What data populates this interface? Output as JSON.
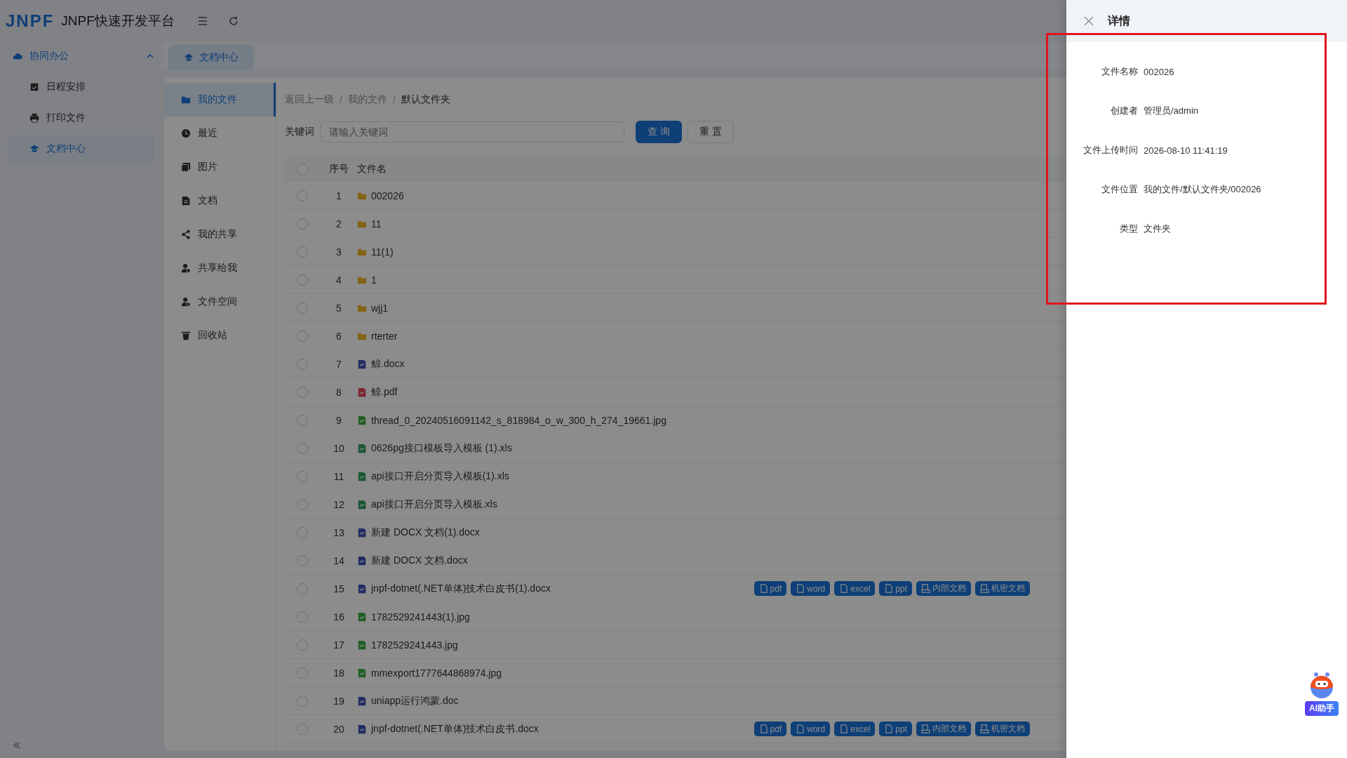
{
  "app": {
    "logo": "JNPF",
    "title": "JNPF快速开发平台"
  },
  "sidebar": {
    "group": {
      "label": "协同办公",
      "expanded": true,
      "items": [
        {
          "label": "日程安排",
          "selected": false
        },
        {
          "label": "打印文件",
          "selected": false
        },
        {
          "label": "文档中心",
          "selected": true
        }
      ]
    }
  },
  "tabs": [
    {
      "label": "文档中心",
      "selected": true
    }
  ],
  "nav": [
    {
      "label": "我的文件",
      "selected": true
    },
    {
      "label": "最近",
      "selected": false
    },
    {
      "label": "图片",
      "selected": false
    },
    {
      "label": "文档",
      "selected": false
    },
    {
      "label": "我的共享",
      "selected": false
    },
    {
      "label": "共享给我",
      "selected": false
    },
    {
      "label": "文件空间",
      "selected": false
    },
    {
      "label": "回收站",
      "selected": false
    }
  ],
  "breadcrumb": [
    {
      "label": "返回上一级"
    },
    {
      "separator": "/",
      "label": "我的文件"
    },
    {
      "separator": "/",
      "label": "默认文件夹"
    }
  ],
  "search": {
    "label": "关键词",
    "placeholder": "请输入关键词",
    "buttons": [
      {
        "label": "查 询",
        "kind": "primary"
      },
      {
        "label": "重 置",
        "kind": "default"
      }
    ]
  },
  "table": {
    "columns": [
      "序号",
      "文件名"
    ],
    "all_checked": false,
    "rows": [
      {
        "index": "1",
        "name": "002026",
        "kind": "folder",
        "checked": false
      },
      {
        "index": "2",
        "name": "11",
        "kind": "folder",
        "checked": false
      },
      {
        "index": "3",
        "name": "11(1)",
        "kind": "folder",
        "checked": false
      },
      {
        "index": "4",
        "name": "1",
        "kind": "folder",
        "checked": false
      },
      {
        "index": "5",
        "name": "wjj1",
        "kind": "folder",
        "checked": false
      },
      {
        "index": "6",
        "name": "rterter",
        "kind": "folder",
        "checked": false
      },
      {
        "index": "7",
        "name": "鲸.docx",
        "kind": "word",
        "checked": false
      },
      {
        "index": "8",
        "name": "鲸.pdf",
        "kind": "pdf",
        "checked": false
      },
      {
        "index": "9",
        "name": "thread_0_20240516091142_s_818984_o_w_300_h_274_19661.jpg",
        "kind": "image",
        "checked": false
      },
      {
        "index": "10",
        "name": "0626pg接口模板导入模板 (1).xls",
        "kind": "excel",
        "checked": false
      },
      {
        "index": "11",
        "name": "api接口开启分页导入模板(1).xls",
        "kind": "excel",
        "checked": false
      },
      {
        "index": "12",
        "name": "api接口开启分页导入模板.xls",
        "kind": "excel",
        "checked": false
      },
      {
        "index": "13",
        "name": "新建 DOCX 文档(1).docx",
        "kind": "word",
        "checked": false
      },
      {
        "index": "14",
        "name": "新建 DOCX 文档.docx",
        "kind": "word",
        "checked": false
      },
      {
        "index": "15",
        "name": "jnpf-dotnet(.NET单体)技术白皮书(1).docx",
        "kind": "word",
        "checked": false,
        "tags": [
          {
            "label": "pdf",
            "kind": "pdf"
          },
          {
            "label": "word",
            "kind": "word"
          },
          {
            "label": "excel",
            "kind": "excel"
          },
          {
            "label": "ppt",
            "kind": "ppt"
          },
          {
            "label": "内部文档",
            "kind": "internal"
          },
          {
            "label": "机密文档",
            "kind": "secret"
          }
        ]
      },
      {
        "index": "16",
        "name": "1782529241443(1).jpg",
        "kind": "image",
        "checked": false
      },
      {
        "index": "17",
        "name": "1782529241443.jpg",
        "kind": "image",
        "checked": false
      },
      {
        "index": "18",
        "name": "mmexport1777644868974.jpg",
        "kind": "image",
        "checked": false
      },
      {
        "index": "19",
        "name": "uniapp运行鸿蒙.doc",
        "kind": "word",
        "checked": false
      },
      {
        "index": "20",
        "name": "jnpf-dotnet(.NET单体)技术白皮书.docx",
        "kind": "word",
        "checked": false,
        "tags": [
          {
            "label": "pdf",
            "kind": "pdf"
          },
          {
            "label": "word",
            "kind": "word"
          },
          {
            "label": "excel",
            "kind": "excel"
          },
          {
            "label": "ppt",
            "kind": "ppt"
          },
          {
            "label": "内部文档",
            "kind": "internal"
          },
          {
            "label": "机密文档",
            "kind": "secret"
          }
        ]
      }
    ]
  },
  "drawer": {
    "title": "详情",
    "fields": [
      {
        "label": "文件名称",
        "value": "002026"
      },
      {
        "label": "创建者",
        "value": "管理员/admin"
      },
      {
        "label": "文件上传时间",
        "value": "2026-08-10 11:41:19"
      },
      {
        "label": "文件位置",
        "value": "我的文件/默认文件夹/002026"
      },
      {
        "label": "类型",
        "value": "文件夹"
      }
    ]
  },
  "assistant": {
    "label": "AI助手"
  }
}
